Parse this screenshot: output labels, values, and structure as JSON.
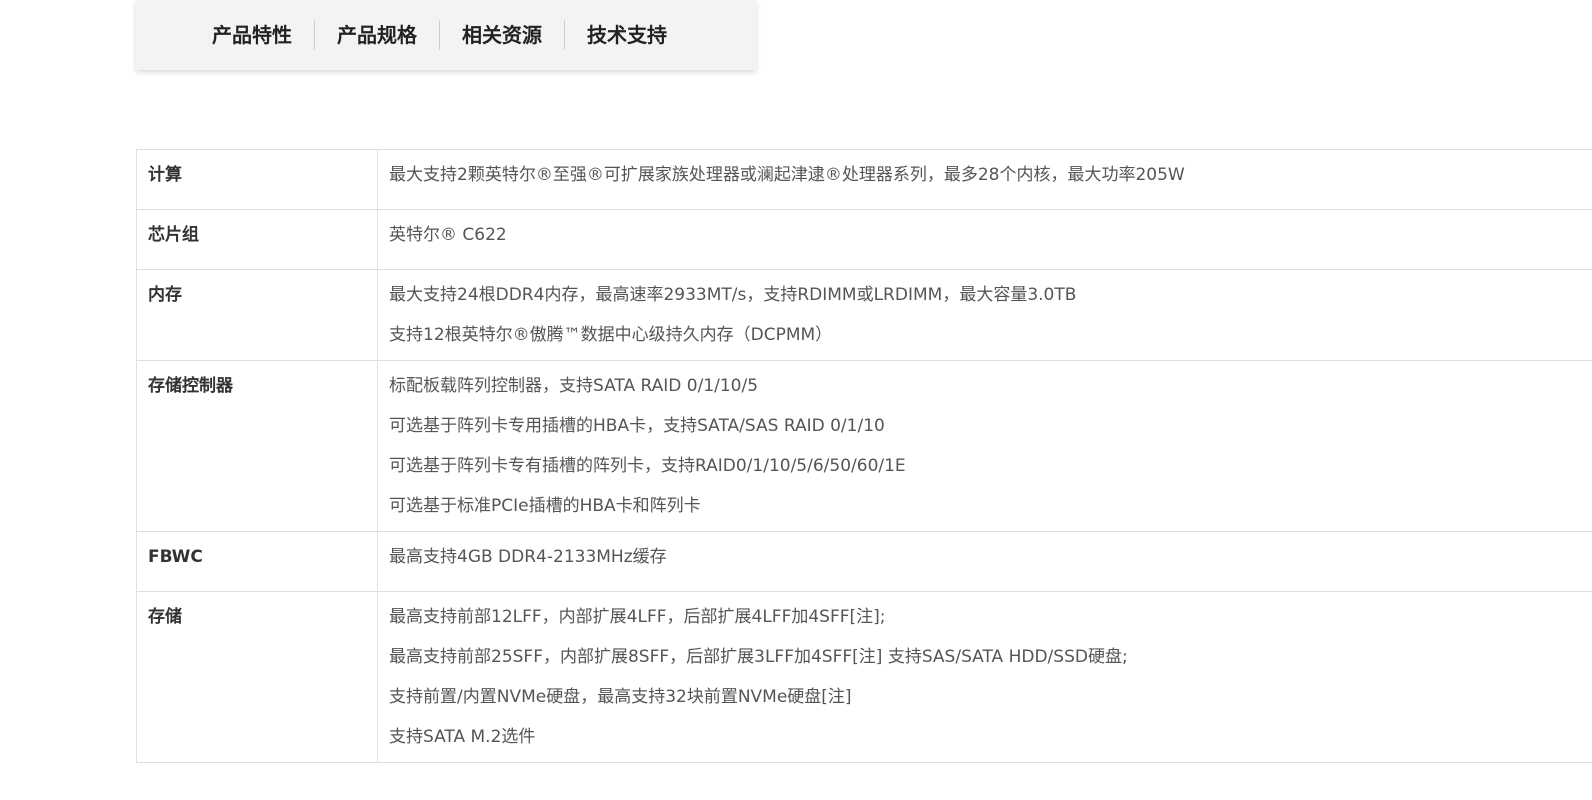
{
  "tabs": [
    "产品特性",
    "产品规格",
    "相关资源",
    "技术支持"
  ],
  "specs": [
    {
      "label": "计算",
      "values": [
        "最大支持2颗英特尔®至强®可扩展家族处理器或澜起津逮®处理器系列，最多28个内核，最大功率205W"
      ]
    },
    {
      "label": "芯片组",
      "values": [
        "英特尔® C622"
      ]
    },
    {
      "label": "内存",
      "values": [
        "最大支持24根DDR4内存，最高速率2933MT/s，支持RDIMM或LRDIMM，最大容量3.0TB",
        "支持12根英特尔®傲腾™数据中心级持久内存（DCPMM）"
      ]
    },
    {
      "label": "存储控制器",
      "values": [
        "标配板载阵列控制器，支持SATA RAID 0/1/10/5",
        "可选基于阵列卡专用插槽的HBA卡，支持SATA/SAS RAID 0/1/10",
        "可选基于阵列卡专有插槽的阵列卡，支持RAID0/1/10/5/6/50/60/1E",
        "可选基于标准PCIe插槽的HBA卡和阵列卡"
      ]
    },
    {
      "label": "FBWC",
      "values": [
        "最高支持4GB DDR4-2133MHz缓存"
      ]
    },
    {
      "label": "存储",
      "values": [
        "最高支持前部12LFF，内部扩展4LFF，后部扩展4LFF加4SFF[注];",
        "最高支持前部25SFF，内部扩展8SFF，后部扩展3LFF加4SFF[注] 支持SAS/SATA HDD/SSD硬盘;",
        "支持前置/内置NVMe硬盘，最高支持32块前置NVMe硬盘[注]",
        "支持SATA M.2选件"
      ]
    }
  ]
}
